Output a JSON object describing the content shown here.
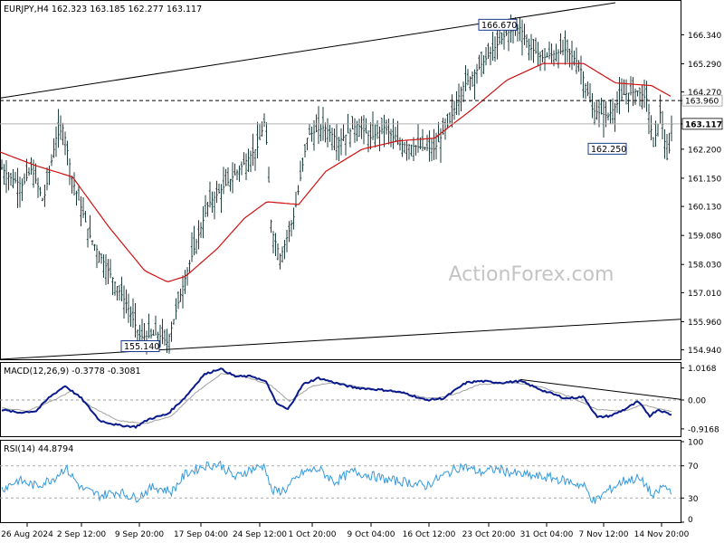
{
  "title": "EURJPY,H4  162.323 163.185 162.277 163.117",
  "watermark": "ActionForex.com",
  "colors": {
    "bars": "#1f3f3f",
    "ma": "#d01010",
    "macd": "#0a1a8c",
    "signal": "#a0a0a0",
    "rsi": "#3399dd",
    "grid": "#d0d0d0",
    "trendline": "#000000",
    "label_border": "#1a3a8a"
  },
  "chart_data": [
    {
      "type": "line",
      "name": "price",
      "symbol": "EURJPY",
      "timeframe": "H4",
      "ohlc_header": {
        "open": 162.323,
        "high": 163.185,
        "low": 162.277,
        "close": 163.117
      },
      "x": [
        "26 Aug 2024",
        "2 Sep 12:00",
        "9 Sep 20:00",
        "17 Sep 04:00",
        "24 Sep 12:00",
        "1 Oct 20:00",
        "9 Oct 04:00",
        "16 Oct 12:00",
        "23 Oct 20:00",
        "31 Oct 04:00",
        "7 Nov 12:00",
        "14 Nov 20:00"
      ],
      "y_ticks": [
        "166.340",
        "165.290",
        "164.270",
        "163.960",
        "163.117",
        "162.200",
        "161.150",
        "160.130",
        "159.080",
        "158.030",
        "157.010",
        "155.960",
        "154.940"
      ],
      "ylim": [
        154.6,
        167.5
      ],
      "anchors": [
        [
          0,
          161.6
        ],
        [
          10,
          161.2
        ],
        [
          25,
          160.9
        ],
        [
          35,
          161.5
        ],
        [
          48,
          160.3
        ],
        [
          62,
          162.6
        ],
        [
          70,
          163.0
        ],
        [
          80,
          161.1
        ],
        [
          100,
          159.0
        ],
        [
          120,
          157.8
        ],
        [
          140,
          156.6
        ],
        [
          155,
          155.4
        ],
        [
          175,
          155.5
        ],
        [
          185,
          155.2
        ],
        [
          205,
          157.6
        ],
        [
          230,
          160.2
        ],
        [
          260,
          161.3
        ],
        [
          285,
          162.3
        ],
        [
          293,
          163.3
        ],
        [
          300,
          159.3
        ],
        [
          310,
          158.3
        ],
        [
          325,
          159.8
        ],
        [
          340,
          162.7
        ],
        [
          358,
          163.0
        ],
        [
          375,
          162.5
        ],
        [
          395,
          163.1
        ],
        [
          410,
          162.6
        ],
        [
          425,
          163.0
        ],
        [
          440,
          162.4
        ],
        [
          460,
          162.3
        ],
        [
          480,
          162.2
        ],
        [
          497,
          163.2
        ],
        [
          510,
          164.4
        ],
        [
          528,
          165.1
        ],
        [
          545,
          165.8
        ],
        [
          560,
          166.4
        ],
        [
          575,
          166.6
        ],
        [
          585,
          165.9
        ],
        [
          600,
          165.5
        ],
        [
          625,
          165.8
        ],
        [
          640,
          165.3
        ],
        [
          655,
          163.6
        ],
        [
          672,
          163.4
        ],
        [
          690,
          164.2
        ],
        [
          705,
          164.3
        ],
        [
          715,
          164.0
        ],
        [
          722,
          162.3
        ],
        [
          730,
          163.6
        ],
        [
          738,
          161.6
        ],
        [
          742,
          163.1
        ]
      ],
      "moving_average": [
        [
          0,
          162.1
        ],
        [
          40,
          161.6
        ],
        [
          80,
          161.2
        ],
        [
          120,
          159.4
        ],
        [
          160,
          157.8
        ],
        [
          185,
          157.4
        ],
        [
          205,
          157.6
        ],
        [
          240,
          158.6
        ],
        [
          270,
          159.7
        ],
        [
          295,
          160.3
        ],
        [
          330,
          160.2
        ],
        [
          360,
          161.4
        ],
        [
          400,
          162.2
        ],
        [
          440,
          162.5
        ],
        [
          480,
          162.6
        ],
        [
          520,
          163.6
        ],
        [
          560,
          164.7
        ],
        [
          600,
          165.3
        ],
        [
          645,
          165.3
        ],
        [
          680,
          164.6
        ],
        [
          720,
          164.5
        ],
        [
          742,
          164.1
        ]
      ],
      "horizontal_levels": [
        163.96,
        163.117
      ],
      "channel": {
        "upper": [
          [
            0,
            164.05
          ],
          [
            680,
            167.5
          ]
        ],
        "lower": [
          [
            0,
            154.6
          ],
          [
            752,
            156.05
          ]
        ]
      },
      "labels": [
        {
          "text": "166.670",
          "x": 550,
          "y": 166.67
        },
        {
          "text": "162.250",
          "x": 690,
          "y": 162.25
        },
        {
          "text": "155.140",
          "x": 155,
          "y": 155.14
        }
      ],
      "level_tags": [
        {
          "text": "163.960",
          "value": 163.96
        },
        {
          "text": "163.117",
          "value": 163.117
        }
      ]
    },
    {
      "type": "line",
      "name": "MACD",
      "label": "MACD(12,26,9) -0.3778 -0.3081",
      "y_ticks": [
        "1.0168",
        "0.00",
        "-0.9168"
      ],
      "ylim": [
        -1.15,
        1.15
      ],
      "macd": [
        [
          0,
          -0.3
        ],
        [
          20,
          -0.4
        ],
        [
          40,
          -0.35
        ],
        [
          55,
          0.1
        ],
        [
          72,
          0.45
        ],
        [
          90,
          0.05
        ],
        [
          110,
          -0.65
        ],
        [
          130,
          -0.8
        ],
        [
          150,
          -0.85
        ],
        [
          165,
          -0.6
        ],
        [
          185,
          -0.45
        ],
        [
          205,
          0.1
        ],
        [
          225,
          0.8
        ],
        [
          243,
          1.0
        ],
        [
          260,
          0.75
        ],
        [
          280,
          0.75
        ],
        [
          295,
          0.55
        ],
        [
          305,
          -0.1
        ],
        [
          318,
          -0.3
        ],
        [
          335,
          0.5
        ],
        [
          352,
          0.7
        ],
        [
          370,
          0.55
        ],
        [
          390,
          0.4
        ],
        [
          410,
          0.35
        ],
        [
          430,
          0.3
        ],
        [
          450,
          0.2
        ],
        [
          470,
          0.0
        ],
        [
          490,
          0.05
        ],
        [
          515,
          0.55
        ],
        [
          530,
          0.6
        ],
        [
          555,
          0.55
        ],
        [
          575,
          0.6
        ],
        [
          600,
          0.3
        ],
        [
          625,
          0.05
        ],
        [
          645,
          0.1
        ],
        [
          660,
          -0.55
        ],
        [
          675,
          -0.5
        ],
        [
          690,
          -0.3
        ],
        [
          705,
          -0.05
        ],
        [
          718,
          -0.5
        ],
        [
          727,
          -0.3
        ],
        [
          740,
          -0.45
        ]
      ],
      "signal": [
        [
          0,
          -0.25
        ],
        [
          30,
          -0.35
        ],
        [
          60,
          0.0
        ],
        [
          80,
          0.3
        ],
        [
          100,
          -0.2
        ],
        [
          130,
          -0.65
        ],
        [
          160,
          -0.75
        ],
        [
          190,
          -0.5
        ],
        [
          215,
          0.2
        ],
        [
          245,
          0.85
        ],
        [
          270,
          0.75
        ],
        [
          300,
          0.45
        ],
        [
          320,
          -0.05
        ],
        [
          345,
          0.45
        ],
        [
          370,
          0.55
        ],
        [
          400,
          0.4
        ],
        [
          440,
          0.25
        ],
        [
          475,
          0.05
        ],
        [
          500,
          0.15
        ],
        [
          530,
          0.5
        ],
        [
          570,
          0.55
        ],
        [
          600,
          0.4
        ],
        [
          630,
          0.1
        ],
        [
          660,
          -0.3
        ],
        [
          690,
          -0.35
        ],
        [
          710,
          -0.15
        ],
        [
          740,
          -0.35
        ]
      ],
      "trendline": [
        [
          575,
          0.65
        ],
        [
          752,
          0.02
        ]
      ]
    },
    {
      "type": "line",
      "name": "RSI",
      "label": "RSI(14) 44.8794",
      "y_ticks": [
        "100",
        "70",
        "30",
        "0"
      ],
      "ylim": [
        0,
        100
      ],
      "dashed_levels": [
        70,
        30
      ],
      "values": [
        [
          0,
          40
        ],
        [
          20,
          52
        ],
        [
          40,
          45
        ],
        [
          60,
          55
        ],
        [
          72,
          68
        ],
        [
          90,
          42
        ],
        [
          110,
          33
        ],
        [
          130,
          38
        ],
        [
          150,
          30
        ],
        [
          170,
          44
        ],
        [
          190,
          38
        ],
        [
          205,
          60
        ],
        [
          225,
          70
        ],
        [
          243,
          72
        ],
        [
          260,
          55
        ],
        [
          275,
          65
        ],
        [
          293,
          70
        ],
        [
          300,
          38
        ],
        [
          315,
          40
        ],
        [
          335,
          62
        ],
        [
          352,
          66
        ],
        [
          370,
          50
        ],
        [
          390,
          63
        ],
        [
          410,
          58
        ],
        [
          430,
          52
        ],
        [
          450,
          50
        ],
        [
          470,
          45
        ],
        [
          490,
          58
        ],
        [
          510,
          70
        ],
        [
          530,
          62
        ],
        [
          550,
          66
        ],
        [
          570,
          60
        ],
        [
          590,
          57
        ],
        [
          610,
          55
        ],
        [
          630,
          50
        ],
        [
          645,
          45
        ],
        [
          657,
          25
        ],
        [
          670,
          38
        ],
        [
          690,
          52
        ],
        [
          705,
          54
        ],
        [
          715,
          45
        ],
        [
          722,
          30
        ],
        [
          732,
          45
        ],
        [
          740,
          40
        ]
      ]
    }
  ]
}
